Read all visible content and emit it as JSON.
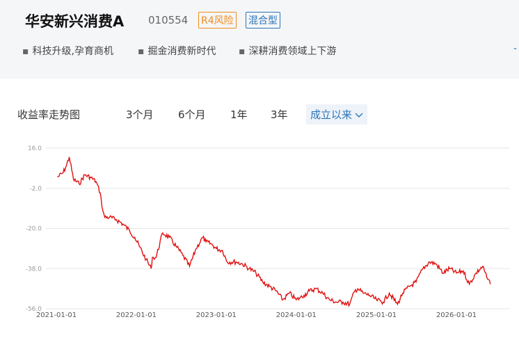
{
  "fund": {
    "name": "华安新兴消费A",
    "code": "010554",
    "risk_tag": "R4风险",
    "type_tag": "混合型",
    "features": [
      "科技升级,孕育商机",
      "掘金消费新时代",
      "深耕消费领域上下游"
    ]
  },
  "chart_section": {
    "title": "收益率走势图",
    "tabs": [
      "3个月",
      "6个月",
      "1年",
      "3年",
      "成立以来"
    ],
    "active_tab": "成立以来",
    "chevron_icon": "chevron-down-icon"
  },
  "colors": {
    "line": "#e01010",
    "accent": "#2b74b7",
    "risk": "#f08b1c"
  },
  "chart_data": {
    "type": "line",
    "title": "",
    "xlabel": "",
    "ylabel": "",
    "ylim": [
      -56,
      16
    ],
    "yticks": [
      "16.0",
      "-2.0",
      "-20.0",
      "-38.0",
      "-56.0"
    ],
    "xticks": [
      "2021-01-01",
      "2022-01-01",
      "2023-01-01",
      "2024-01-01",
      "2025-01-01",
      "2026-01-01"
    ],
    "series": [
      {
        "x": [
          "2021-01-06",
          "2021-02-01",
          "2021-02-15",
          "2021-03-01",
          "2021-03-20",
          "2021-04-15",
          "2021-05-10",
          "2021-06-05",
          "2021-07-01",
          "2021-07-20",
          "2021-08-01",
          "2021-08-10",
          "2021-09-01",
          "2021-10-01",
          "2021-11-01",
          "2021-12-01",
          "2021-12-25",
          "2022-01-15",
          "2022-02-15",
          "2022-03-10",
          "2022-03-15",
          "2022-04-01",
          "2022-05-01",
          "2022-06-01",
          "2022-07-01",
          "2022-08-01",
          "2022-09-01",
          "2022-10-01",
          "2022-10-31",
          "2022-11-15",
          "2022-12-10",
          "2023-01-01",
          "2023-01-30",
          "2023-02-20",
          "2023-04-01",
          "2023-05-01",
          "2023-06-01",
          "2023-07-01",
          "2023-08-01",
          "2023-09-01",
          "2023-10-01",
          "2023-11-01",
          "2023-12-01",
          "2024-01-01",
          "2024-01-20",
          "2024-02-05",
          "2024-03-01",
          "2024-04-01",
          "2024-05-01",
          "2024-06-01",
          "2024-07-01",
          "2024-08-01",
          "2024-09-01",
          "2024-09-24",
          "2024-10-08",
          "2024-11-01",
          "2024-12-01",
          "2025-01-01",
          "2025-02-01",
          "2025-03-01",
          "2025-04-07",
          "2025-05-01",
          "2025-06-01",
          "2025-07-01",
          "2025-08-01",
          "2025-09-01",
          "2025-10-01",
          "2025-11-01",
          "2025-12-01",
          "2026-01-01",
          "2026-02-01",
          "2026-03-01",
          "2026-04-01",
          "2026-05-01",
          "2026-05-20",
          "2026-06-05"
        ],
        "y": [
          3,
          5,
          8,
          12,
          2,
          0,
          4,
          3,
          1,
          -4,
          -12,
          -15,
          -15,
          -16,
          -18,
          -21,
          -24,
          -28,
          -34,
          -38,
          -33,
          -33,
          -22,
          -24,
          -28,
          -32,
          -37,
          -29,
          -24,
          -26,
          -27,
          -29,
          -30,
          -35,
          -35,
          -36,
          -38,
          -40,
          -44,
          -46,
          -48,
          -52,
          -49,
          -52,
          -51,
          -50,
          -48,
          -47,
          -49,
          -52,
          -53,
          -53,
          -54,
          -48,
          -47,
          -49,
          -50,
          -52,
          -53,
          -49,
          -54,
          -49,
          -46,
          -44,
          -38,
          -35,
          -36,
          -40,
          -38,
          -40,
          -39,
          -45,
          -40,
          -37,
          -42,
          -45
        ]
      }
    ]
  }
}
